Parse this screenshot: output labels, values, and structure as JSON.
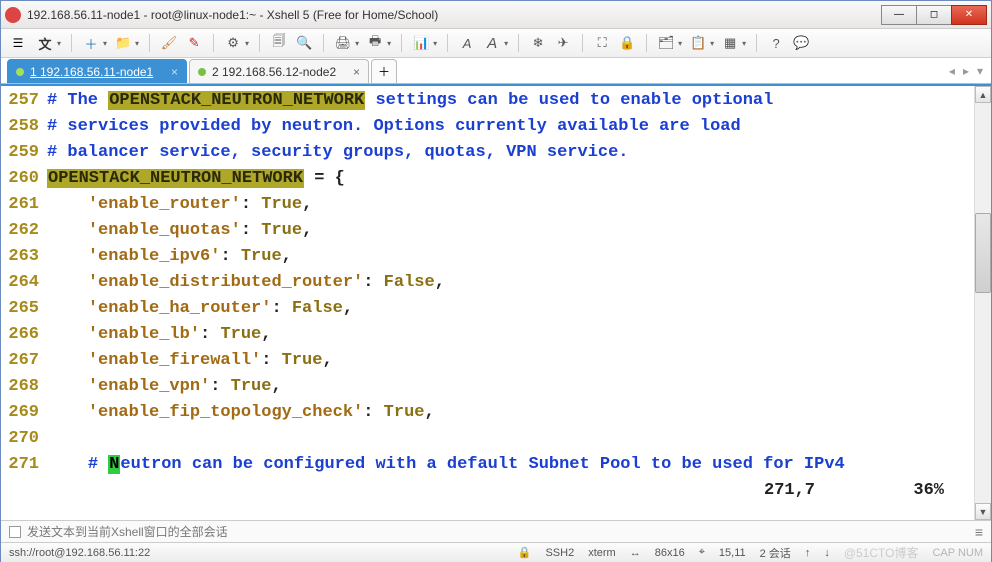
{
  "window": {
    "title": "192.168.56.11-node1 - root@linux-node1:~ - Xshell 5 (Free for Home/School)"
  },
  "toolbar_icons": [
    "文",
    "＋",
    "📁",
    "🖌",
    "✎",
    "⚙",
    "🗐",
    "🔍",
    "🖨",
    "🖶",
    "📊",
    "A",
    "A",
    "❄",
    "✈",
    "⛶",
    "🔒",
    "🗂",
    "📋",
    "▦",
    "?",
    "💬"
  ],
  "tabs": [
    {
      "label": "1 192.168.56.11-node1",
      "active": true
    },
    {
      "label": "2 192.168.56.12-node2",
      "active": false
    }
  ],
  "code_lines": [
    {
      "n": "257",
      "comment_pre": "# The ",
      "hl": "OPENSTACK_NEUTRON_NETWORK",
      "comment_post": " settings can be used to enable optional"
    },
    {
      "n": "258",
      "comment": "# services provided by neutron. Options currently available are load"
    },
    {
      "n": "259",
      "comment": "# balancer service, security groups, quotas, VPN service."
    },
    {
      "n": "260",
      "hl": "OPENSTACK_NEUTRON_NETWORK",
      "plain_post": " = {"
    },
    {
      "n": "261",
      "indent": "    ",
      "key": "'enable_router'",
      "sep": ": ",
      "val": "True",
      "tail": ","
    },
    {
      "n": "262",
      "indent": "    ",
      "key": "'enable_quotas'",
      "sep": ": ",
      "val": "True",
      "tail": ","
    },
    {
      "n": "263",
      "indent": "    ",
      "key": "'enable_ipv6'",
      "sep": ": ",
      "val": "True",
      "tail": ","
    },
    {
      "n": "264",
      "indent": "    ",
      "key": "'enable_distributed_router'",
      "sep": ": ",
      "val": "False",
      "tail": ","
    },
    {
      "n": "265",
      "indent": "    ",
      "key": "'enable_ha_router'",
      "sep": ": ",
      "val": "False",
      "tail": ","
    },
    {
      "n": "266",
      "indent": "    ",
      "key": "'enable_lb'",
      "sep": ": ",
      "val": "True",
      "tail": ","
    },
    {
      "n": "267",
      "indent": "    ",
      "key": "'enable_firewall'",
      "sep": ": ",
      "val": "True",
      "tail": ","
    },
    {
      "n": "268",
      "indent": "    ",
      "key": "'enable_vpn'",
      "sep": ": ",
      "val": "True",
      "tail": ","
    },
    {
      "n": "269",
      "indent": "    ",
      "key": "'enable_fip_topology_check'",
      "sep": ": ",
      "val": "True",
      "tail": ","
    },
    {
      "n": "270",
      "blank": true
    },
    {
      "n": "271",
      "indent": "    ",
      "comment_pre": "# ",
      "cursor": "N",
      "comment_post": "eutron can be configured with a default Subnet Pool to be used for IPv4"
    }
  ],
  "vim": {
    "pos": "271,7",
    "pct": "36%"
  },
  "bottom": {
    "hint": "发送文本到当前Xshell窗口的全部会话"
  },
  "status": {
    "conn": "ssh://root@192.168.56.11:22",
    "ssh": "SSH2",
    "term": "xterm",
    "size": "86x16",
    "cursor": "15,11",
    "sessions": "2 会话",
    "caps": "CAP NUM",
    "watermark": "@51CTO博客"
  }
}
